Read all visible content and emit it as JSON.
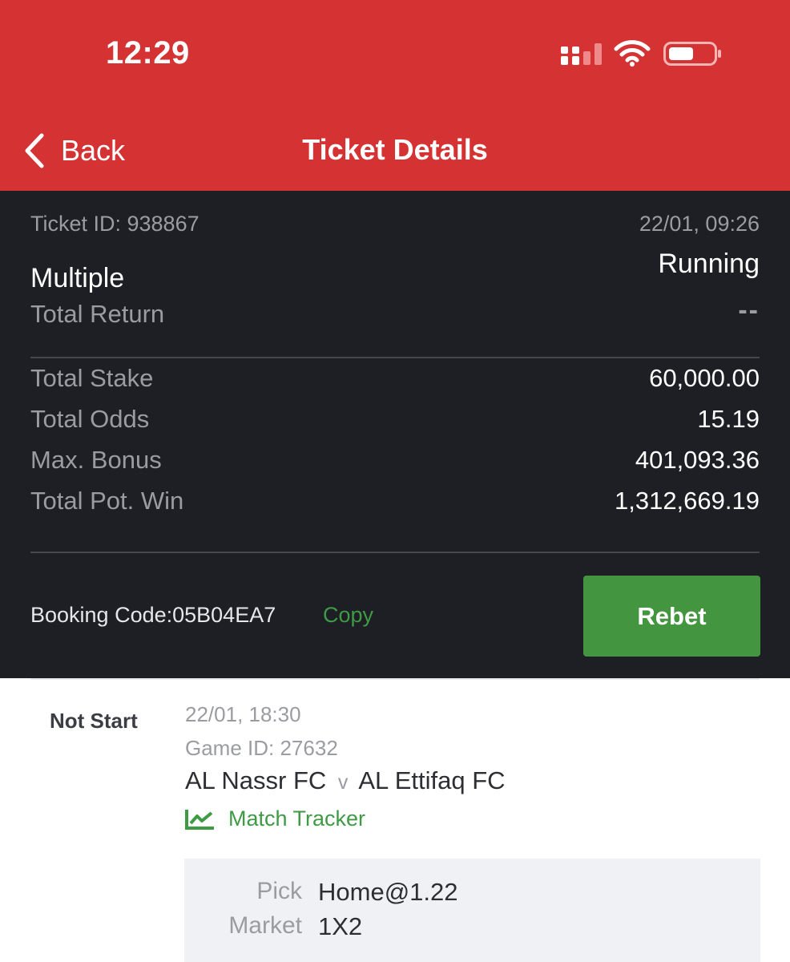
{
  "status_bar": {
    "time": "12:29",
    "icons": [
      "signal-icon",
      "wifi-icon",
      "battery-icon"
    ]
  },
  "nav": {
    "back_label": "Back",
    "title": "Ticket Details"
  },
  "ticket": {
    "id_text": "Ticket ID: 938867",
    "datetime": "22/01, 09:26",
    "type": "Multiple",
    "status": "Running",
    "total_return_label": "Total Return",
    "total_return_value": "--",
    "rows": [
      {
        "label": "Total Stake",
        "value": "60,000.00"
      },
      {
        "label": "Total Odds",
        "value": "15.19"
      },
      {
        "label": "Max. Bonus",
        "value": "401,093.36"
      },
      {
        "label": "Total Pot. Win",
        "value": "1,312,669.19"
      }
    ],
    "booking_text": "Booking Code:05B04EA7",
    "copy_label": "Copy",
    "rebet_label": "Rebet"
  },
  "selection": {
    "status": "Not Start",
    "kickoff": "22/01, 18:30",
    "game_id_text": "Game ID: 27632",
    "home": "AL Nassr FC",
    "separator": "v",
    "away": "AL Ettifaq FC",
    "tracker_label": "Match Tracker",
    "pick_label": "Pick",
    "pick_value": "Home@1.22",
    "market_label": "Market",
    "market_value": "1X2"
  },
  "colors": {
    "header_red": "#d53333",
    "summary_dark": "#1d1f24",
    "accent_green": "#43963f",
    "muted_text": "#9a9ca2"
  }
}
